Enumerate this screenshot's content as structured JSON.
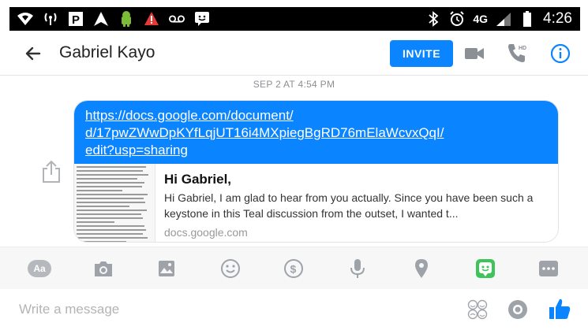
{
  "status_bar": {
    "time": "4:26",
    "network": "4G",
    "icons": [
      "wifi-icon",
      "hotspot-icon",
      "parking-icon",
      "navigation-icon",
      "android-icon",
      "warning-icon",
      "voicemail-icon",
      "messenger-icon",
      "bluetooth-icon",
      "alarm-icon",
      "signal-icon",
      "battery-icon"
    ]
  },
  "header": {
    "contact_name": "Gabriel Kayo",
    "invite_label": "INVITE"
  },
  "conversation": {
    "timestamp": "SEP 2 AT 4:54 PM",
    "message": {
      "link_lines": [
        "https://docs.google.com/document/",
        "d/17pwZWwDpKYfLqjUT16i4MXpiegBgRD76mElaWcvxQqI/",
        "edit?usp=sharing"
      ],
      "preview": {
        "title": "Hi Gabriel,",
        "description": "Hi Gabriel, I am glad to hear from you actually. Since you have been such a keystone in this Teal discussion from the outset, I wanted t...",
        "domain": "docs.google.com"
      }
    }
  },
  "toolbar": {
    "aa_label": "Aa",
    "items": [
      "text-style-icon",
      "camera-icon",
      "gallery-icon",
      "emoji-icon",
      "payment-icon",
      "microphone-icon",
      "location-icon",
      "sticker-icon",
      "more-icon"
    ]
  },
  "composer": {
    "placeholder": "Write a message"
  },
  "colors": {
    "accent": "#0b84ff",
    "sticker_green": "#3ec45a",
    "toolbar_icons": "#9ea3a9"
  }
}
